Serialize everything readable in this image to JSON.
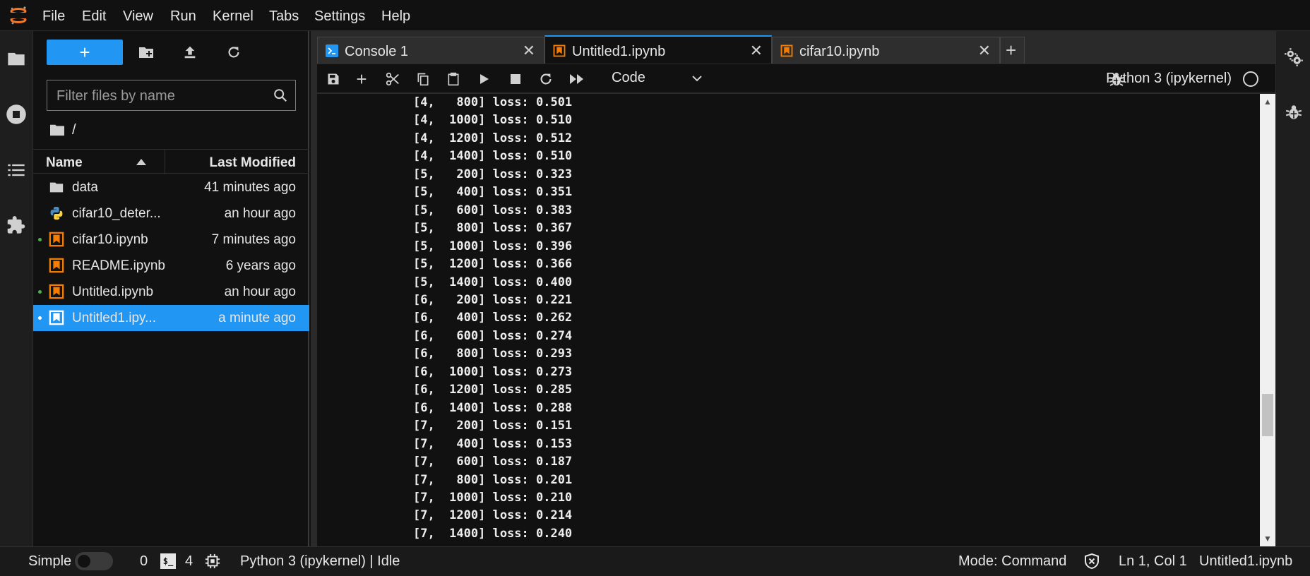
{
  "menu": {
    "items": [
      "File",
      "Edit",
      "View",
      "Run",
      "Kernel",
      "Tabs",
      "Settings",
      "Help"
    ]
  },
  "activity_bar": {
    "icons": [
      "folder-icon",
      "stop-circle-icon",
      "list-icon",
      "puzzle-icon"
    ]
  },
  "file_browser": {
    "new_label": "+",
    "filter_placeholder": "Filter files by name",
    "breadcrumb": "/",
    "columns": {
      "name": "Name",
      "modified": "Last Modified"
    },
    "files": [
      {
        "name": "data",
        "modified": "41 minutes ago",
        "type": "folder",
        "running": false,
        "selected": false
      },
      {
        "name": "cifar10_deter...",
        "modified": "an hour ago",
        "type": "python",
        "running": false,
        "selected": false
      },
      {
        "name": "cifar10.ipynb",
        "modified": "7 minutes ago",
        "type": "notebook",
        "running": true,
        "selected": false
      },
      {
        "name": "README.ipynb",
        "modified": "6 years ago",
        "type": "notebook",
        "running": false,
        "selected": false
      },
      {
        "name": "Untitled.ipynb",
        "modified": "an hour ago",
        "type": "notebook",
        "running": true,
        "selected": false
      },
      {
        "name": "Untitled1.ipy...",
        "modified": "a minute ago",
        "type": "notebook",
        "running": true,
        "selected": true
      }
    ]
  },
  "tabs": [
    {
      "label": "Console 1",
      "type": "console",
      "active": false
    },
    {
      "label": "Untitled1.ipynb",
      "type": "notebook",
      "active": true
    },
    {
      "label": "cifar10.ipynb",
      "type": "notebook",
      "active": false
    }
  ],
  "notebook_toolbar": {
    "cell_type": "Code",
    "kernel_name": "Python 3 (ipykernel)"
  },
  "output_lines": [
    "[4,   800] loss: 0.501",
    "[4,  1000] loss: 0.510",
    "[4,  1200] loss: 0.512",
    "[4,  1400] loss: 0.510",
    "[5,   200] loss: 0.323",
    "[5,   400] loss: 0.351",
    "[5,   600] loss: 0.383",
    "[5,   800] loss: 0.367",
    "[5,  1000] loss: 0.396",
    "[5,  1200] loss: 0.366",
    "[5,  1400] loss: 0.400",
    "[6,   200] loss: 0.221",
    "[6,   400] loss: 0.262",
    "[6,   600] loss: 0.274",
    "[6,   800] loss: 0.293",
    "[6,  1000] loss: 0.273",
    "[6,  1200] loss: 0.285",
    "[6,  1400] loss: 0.288",
    "[7,   200] loss: 0.151",
    "[7,   400] loss: 0.153",
    "[7,   600] loss: 0.187",
    "[7,   800] loss: 0.201",
    "[7,  1000] loss: 0.210",
    "[7,  1200] loss: 0.214",
    "[7,  1400] loss: 0.240"
  ],
  "statusbar": {
    "mode_label": "Simple",
    "terminals_count": "0",
    "kernels_count": "4",
    "kernel_status": "Python 3 (ipykernel) | Idle",
    "mode": "Mode: Command",
    "cursor": "Ln 1, Col 1",
    "filename": "Untitled1.ipynb"
  },
  "colors": {
    "accent": "#2196f3",
    "notebook_icon": "#f57c00",
    "running_dot": "#4caf50"
  }
}
